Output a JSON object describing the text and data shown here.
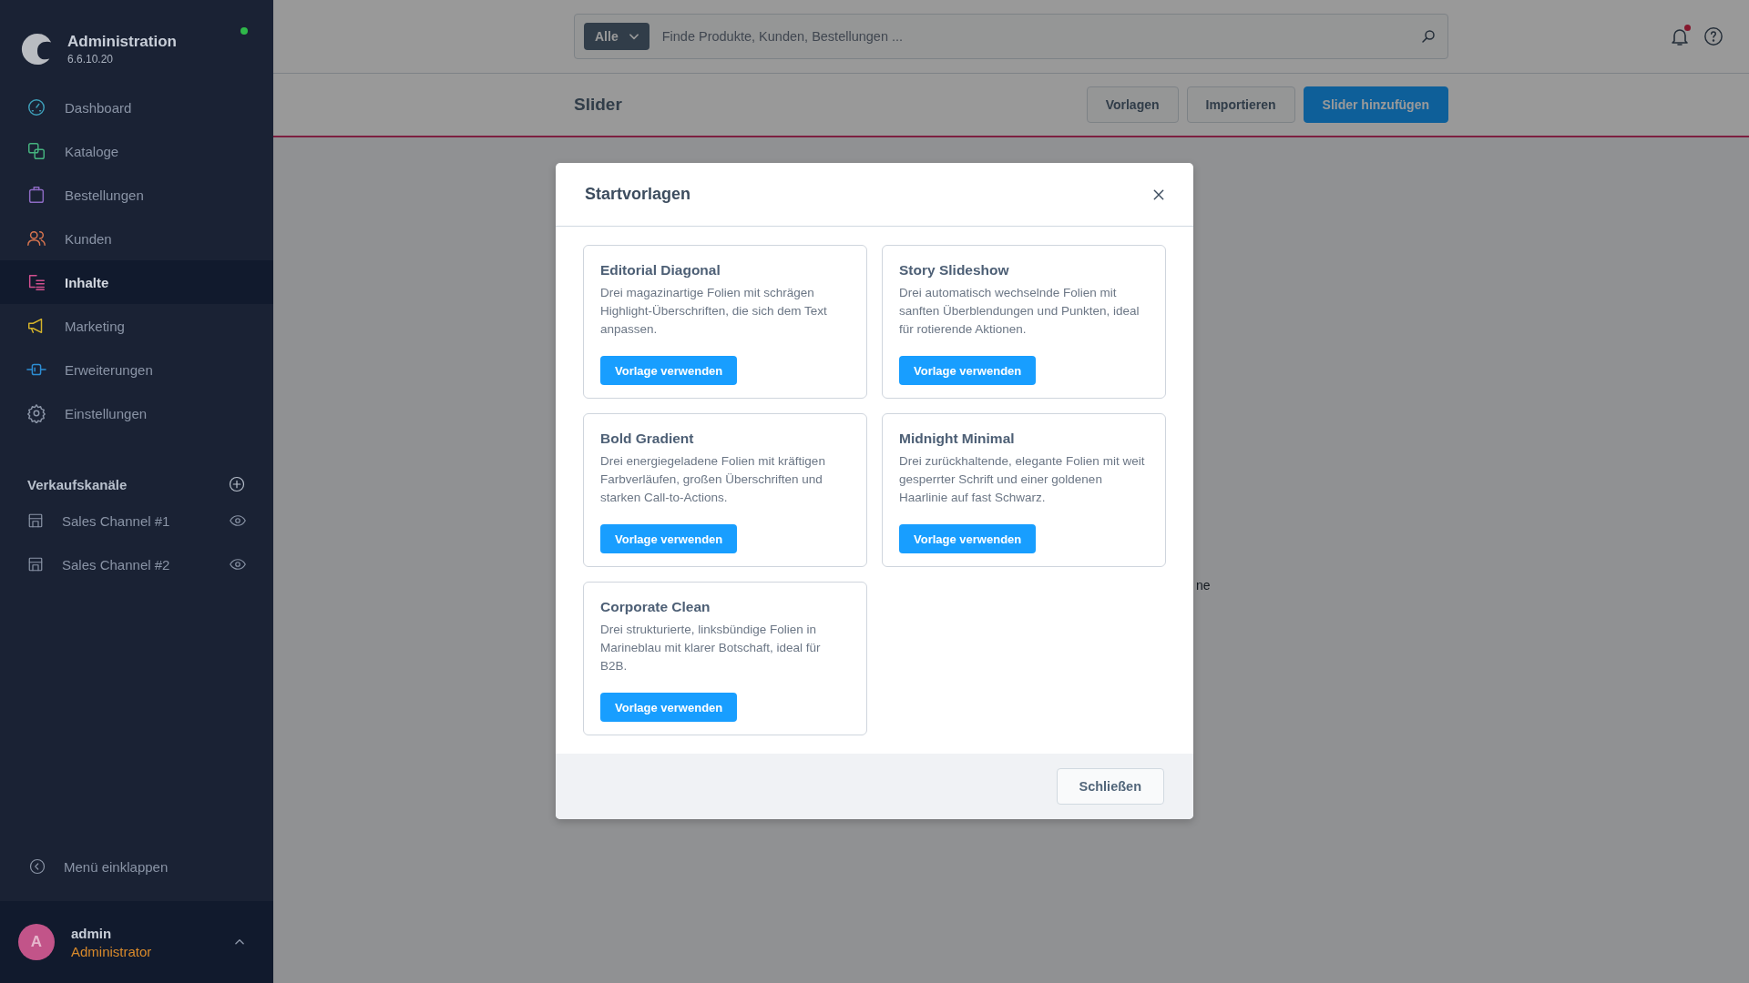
{
  "sidebar": {
    "app_name": "Administration",
    "version": "6.6.10.20",
    "online": true,
    "nav": [
      {
        "label": "Dashboard",
        "color": "#3e9eb8",
        "selected": false
      },
      {
        "label": "Kataloge",
        "color": "#45b27e",
        "selected": false
      },
      {
        "label": "Bestellungen",
        "color": "#8c6ac2",
        "selected": false
      },
      {
        "label": "Kunden",
        "color": "#d8754f",
        "selected": false
      },
      {
        "label": "Inhalte",
        "color": "#d14f8f",
        "selected": true
      },
      {
        "label": "Marketing",
        "color": "#d6b42a",
        "selected": false
      },
      {
        "label": "Erweiterungen",
        "color": "#2d8ed4",
        "selected": false
      },
      {
        "label": "Einstellungen",
        "color": "#8a94a6",
        "selected": false
      }
    ],
    "sales_channels": {
      "title": "Verkaufskanäle",
      "items": [
        {
          "label": "Sales Channel #1"
        },
        {
          "label": "Sales Channel #2"
        }
      ]
    },
    "collapse": "Menü einklappen",
    "user": {
      "initial": "A",
      "name": "admin",
      "role": "Administrator"
    }
  },
  "header": {
    "search_scope": "Alle",
    "search_placeholder": "Finde Produkte, Kunden, Bestellungen ...",
    "notification": true
  },
  "page": {
    "title": "Slider",
    "buttons": [
      {
        "label": "Vorlagen",
        "kind": "secondary"
      },
      {
        "label": "Importieren",
        "kind": "secondary"
      },
      {
        "label": "Slider hinzufügen",
        "kind": "primary"
      }
    ],
    "background_text": "ne"
  },
  "modal": {
    "title": "Startvorlagen",
    "templates": [
      {
        "title": "Editorial Diagonal",
        "description": "Drei magazinartige Folien mit schrägen Highlight-Überschriften, die sich dem Text anpassen.",
        "button": "Vorlage verwenden"
      },
      {
        "title": "Story Slideshow",
        "description": "Drei automatisch wechselnde Folien mit sanften Überblendungen und Punkten, ideal für rotierende Aktionen.",
        "button": "Vorlage verwenden"
      },
      {
        "title": "Bold Gradient",
        "description": "Drei energiegeladene Folien mit kräftigen Farbverläufen, großen Überschriften und starken Call-to-Actions.",
        "button": "Vorlage verwenden"
      },
      {
        "title": "Midnight Minimal",
        "description": "Drei zurückhaltende, elegante Folien mit weit gesperrter Schrift und einer goldenen Haarlinie auf fast Schwarz.",
        "button": "Vorlage verwenden"
      },
      {
        "title": "Corporate Clean",
        "description": "Drei strukturierte, linksbündige Folien in Marineblau mit klarer Botschaft, ideal für B2B.",
        "button": "Vorlage verwenden"
      }
    ],
    "close_button": "Schließen"
  }
}
